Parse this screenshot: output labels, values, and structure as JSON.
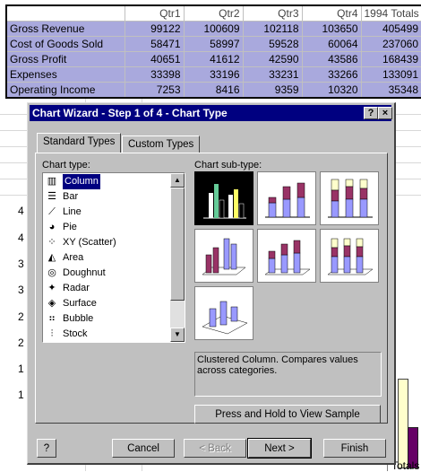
{
  "sheet": {
    "headers": [
      "",
      "Qtr1",
      "Qtr2",
      "Qtr3",
      "Qtr4",
      "1994 Totals"
    ],
    "rows": [
      [
        "Gross Revenue",
        "99122",
        "100609",
        "102118",
        "103650",
        "405499"
      ],
      [
        "Cost of Goods Sold",
        "58471",
        "58997",
        "59528",
        "60064",
        "237060"
      ],
      [
        "Gross Profit",
        "40651",
        "41612",
        "42590",
        "43586",
        "168439"
      ],
      [
        "Expenses",
        "33398",
        "33196",
        "33231",
        "33266",
        "133091"
      ],
      [
        "Operating Income",
        "7253",
        "8416",
        "9359",
        "10320",
        "35348"
      ]
    ]
  },
  "background": {
    "axis_labels": [
      "4",
      "4",
      "3",
      "3",
      "2",
      "2",
      "1",
      "1"
    ],
    "footer_right": "Totals"
  },
  "dialog": {
    "title": "Chart Wizard - Step 1 of 4 - Chart Type",
    "help_glyph": "?",
    "close_glyph": "×",
    "tabs": [
      "Standard Types",
      "Custom Types"
    ],
    "chart_type_label": "Chart type:",
    "chart_subtype_label": "Chart sub-type:",
    "chart_types": [
      {
        "label": "Column",
        "icon": "column-chart-icon",
        "glyph": "▥"
      },
      {
        "label": "Bar",
        "icon": "bar-chart-icon",
        "glyph": "☰"
      },
      {
        "label": "Line",
        "icon": "line-chart-icon",
        "glyph": "⟋"
      },
      {
        "label": "Pie",
        "icon": "pie-chart-icon",
        "glyph": "◕"
      },
      {
        "label": "XY (Scatter)",
        "icon": "scatter-chart-icon",
        "glyph": "⁘"
      },
      {
        "label": "Area",
        "icon": "area-chart-icon",
        "glyph": "◭"
      },
      {
        "label": "Doughnut",
        "icon": "doughnut-chart-icon",
        "glyph": "◎"
      },
      {
        "label": "Radar",
        "icon": "radar-chart-icon",
        "glyph": "✦"
      },
      {
        "label": "Surface",
        "icon": "surface-chart-icon",
        "glyph": "◈"
      },
      {
        "label": "Bubble",
        "icon": "bubble-chart-icon",
        "glyph": "⠶"
      },
      {
        "label": "Stock",
        "icon": "stock-chart-icon",
        "glyph": "⫶"
      }
    ],
    "selected_type": "Column",
    "description": "Clustered Column. Compares values across categories.",
    "preview_button": "Press and Hold to View Sample",
    "buttons": {
      "help": "?",
      "cancel": "Cancel",
      "back": "< Back",
      "next": "Next >",
      "finish": "Finish"
    },
    "colors": {
      "titlebar": "#000080",
      "series1": "#9999ff",
      "series2": "#993366",
      "series3": "#ffffcc"
    }
  }
}
